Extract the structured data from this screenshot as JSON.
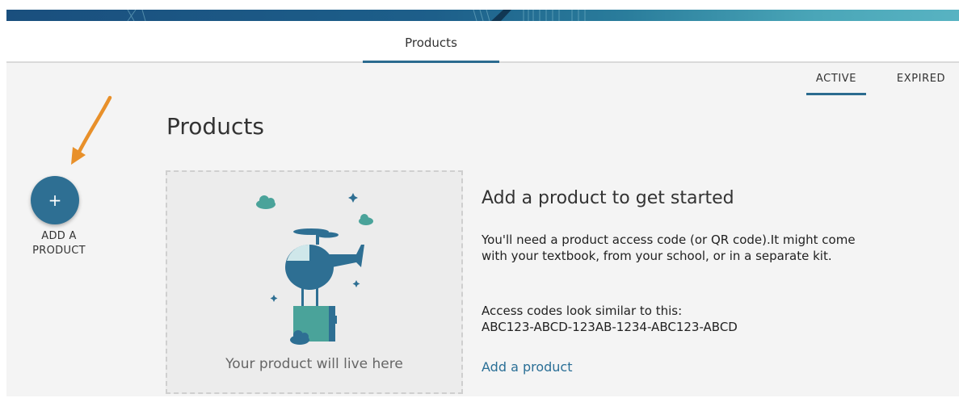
{
  "header": {
    "tab_label": "Products"
  },
  "subtabs": {
    "active": "ACTIVE",
    "expired": "EXPIRED"
  },
  "page": {
    "title": "Products"
  },
  "fab": {
    "icon_glyph": "+",
    "label_line1": "ADD A",
    "label_line2": "PRODUCT"
  },
  "placeholder": {
    "text": "Your product will live here"
  },
  "info": {
    "heading": "Add a product to get started",
    "paragraph1": "You'll need a product access code (or QR code).It might come with your textbook, from your school, or in a separate kit.",
    "paragraph2_line1": "Access codes look similar to this:",
    "paragraph2_line2": "ABC123-ABCD-123AB-1234-ABC123-ABCD",
    "link_label": "Add a product"
  },
  "colors": {
    "accent": "#2e6f93",
    "link": "#2a6f96",
    "arrow": "#e8902a"
  }
}
